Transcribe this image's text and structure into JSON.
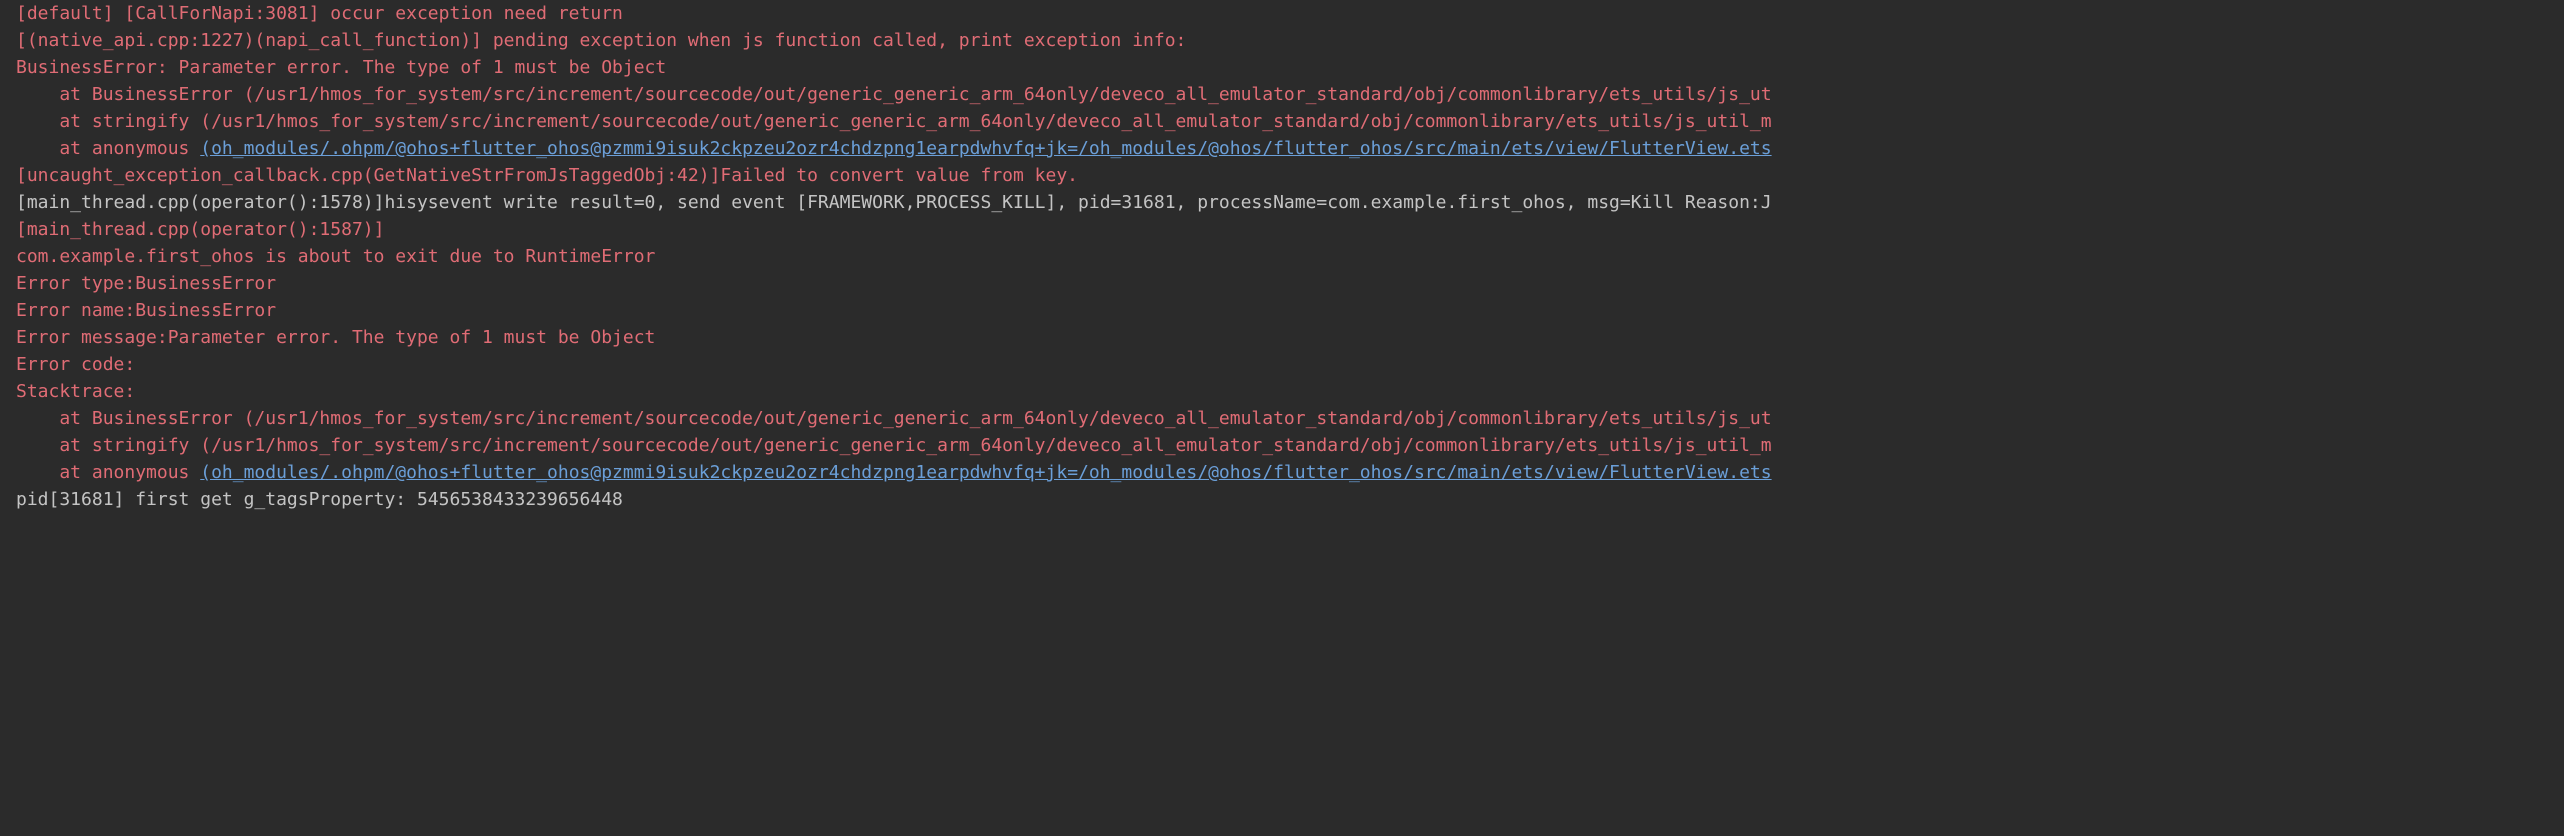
{
  "lines": {
    "l0": "[default] [CallForNapi:3081] occur exception need return",
    "l1": "[(native_api.cpp:1227)(napi_call_function)] pending exception when js function called, print exception info:",
    "l2": "BusinessError: Parameter error. The type of 1 must be Object",
    "l3_prefix": "    at BusinessError (/usr1/hmos_for_system/src/increment/sourcecode/out/generic_generic_arm_64only/deveco_all_emulator_standard/obj/commonlibrary/ets_utils/js_ut",
    "l4_prefix": "    at stringify (/usr1/hmos_for_system/src/increment/sourcecode/out/generic_generic_arm_64only/deveco_all_emulator_standard/obj/commonlibrary/ets_utils/js_util_m",
    "l5_prefix": "    at anonymous ",
    "l5_link": "(oh_modules/.ohpm/@ohos+flutter_ohos@pzmmi9isuk2ckpzeu2ozr4chdzpng1earpdwhvfq+jk=/oh_modules/@ohos/flutter_ohos/src/main/ets/view/FlutterView.ets",
    "l6": "[uncaught_exception_callback.cpp(GetNativeStrFromJsTaggedObj:42)]Failed to convert value from key.",
    "l7": "[main_thread.cpp(operator():1578)]hisysevent write result=0, send event [FRAMEWORK,PROCESS_KILL], pid=31681, processName=com.example.first_ohos, msg=Kill Reason:J",
    "l8": "[main_thread.cpp(operator():1587)]",
    "l9": "com.example.first_ohos is about to exit due to RuntimeError",
    "l10": "Error type:BusinessError",
    "l11": "Error name:BusinessError",
    "l12": "Error message:Parameter error. The type of 1 must be Object",
    "l13": "Error code:",
    "l14": "Stacktrace:",
    "l15_prefix": "    at BusinessError (/usr1/hmos_for_system/src/increment/sourcecode/out/generic_generic_arm_64only/deveco_all_emulator_standard/obj/commonlibrary/ets_utils/js_ut",
    "l16_prefix": "    at stringify (/usr1/hmos_for_system/src/increment/sourcecode/out/generic_generic_arm_64only/deveco_all_emulator_standard/obj/commonlibrary/ets_utils/js_util_m",
    "l17_prefix": "    at anonymous ",
    "l17_link": "(oh_modules/.ohpm/@ohos+flutter_ohos@pzmmi9isuk2ckpzeu2ozr4chdzpng1earpdwhvfq+jk=/oh_modules/@ohos/flutter_ohos/src/main/ets/view/FlutterView.ets",
    "l18": "pid[31681] first get g_tagsProperty: 5456538433239656448"
  }
}
